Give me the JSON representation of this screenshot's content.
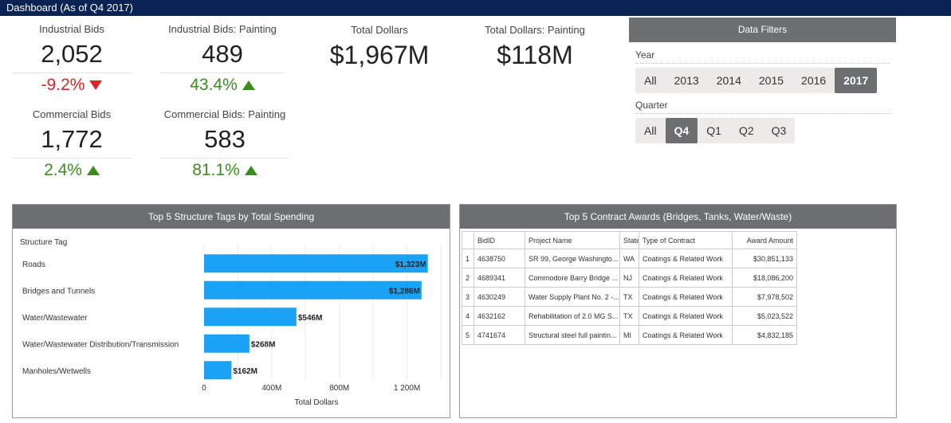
{
  "header": {
    "title": "Dashboard (As of Q4 2017)"
  },
  "kpis": {
    "industrial_bids": {
      "label": "Industrial Bids",
      "value": "2,052",
      "change": "-9.2%",
      "direction": "down"
    },
    "industrial_bids_painting": {
      "label": "Industrial Bids: Painting",
      "value": "489",
      "change": "43.4%",
      "direction": "up"
    },
    "total_dollars": {
      "label": "Total Dollars",
      "value": "$1,967M"
    },
    "total_dollars_painting": {
      "label": "Total Dollars: Painting",
      "value": "$118M"
    },
    "commercial_bids": {
      "label": "Commercial Bids",
      "value": "1,772",
      "change": "2.4%",
      "direction": "up"
    },
    "commercial_bids_painting": {
      "label": "Commercial Bids: Painting",
      "value": "583",
      "change": "81.1%",
      "direction": "up"
    }
  },
  "filters": {
    "title": "Data Filters",
    "year_label": "Year",
    "years": [
      "All",
      "2013",
      "2014",
      "2015",
      "2016",
      "2017"
    ],
    "selected_year": "2017",
    "quarter_label": "Quarter",
    "quarters": [
      "All",
      "Q4",
      "Q1",
      "Q2",
      "Q3"
    ],
    "selected_quarter": "Q4"
  },
  "colors": {
    "header": "#0b2352",
    "panel_header": "#6d6e70",
    "bar": "#1aa3f5",
    "negative": "#d9252b",
    "positive": "#3c8c1e"
  },
  "chart_data": {
    "type": "bar",
    "orientation": "horizontal",
    "title": "Top 5 Structure Tags by Total Spending",
    "category_axis_label": "Structure Tag",
    "xlabel": "Total Dollars",
    "categories": [
      "Roads",
      "Bridges and Tunnels",
      "Water/Wastewater",
      "Water/Wastewater Distribution/Transmission",
      "Manholes/Wetwells"
    ],
    "values": [
      1323,
      1286,
      546,
      268,
      162
    ],
    "value_labels": [
      "$1,323M",
      "$1,286M",
      "$546M",
      "$268M",
      "$162M"
    ],
    "ticks": [
      0,
      400,
      800,
      1200
    ],
    "tick_labels": [
      "0",
      "400M",
      "800M",
      "1 200M"
    ],
    "xlim": [
      0,
      1400
    ],
    "grid": true
  },
  "awards": {
    "title": "Top 5 Contract Awards (Bridges, Tanks, Water/Waste)",
    "columns": [
      "",
      "BidID",
      "Project Name",
      "State",
      "Type of Contract",
      "Award Amount"
    ],
    "rows": [
      [
        "1",
        "4638750",
        "SR 99, George Washingto...",
        "WA",
        "Coatings & Related Work",
        "$30,851,133"
      ],
      [
        "2",
        "4689341",
        "Commodore Barry Bridge ...",
        "NJ",
        "Coatings & Related Work",
        "$18,086,200"
      ],
      [
        "3",
        "4630249",
        "Water Supply Plant No. 2 -...",
        "TX",
        "Coatings & Related Work",
        "$7,978,502"
      ],
      [
        "4",
        "4632162",
        "Rehabilitation of 2.0 MG S...",
        "TX",
        "Coatings & Related Work",
        "$5,023,522"
      ],
      [
        "5",
        "4741674",
        "Structural steel full paintin...",
        "MI",
        "Coatings & Related Work",
        "$4,832,185"
      ]
    ]
  }
}
